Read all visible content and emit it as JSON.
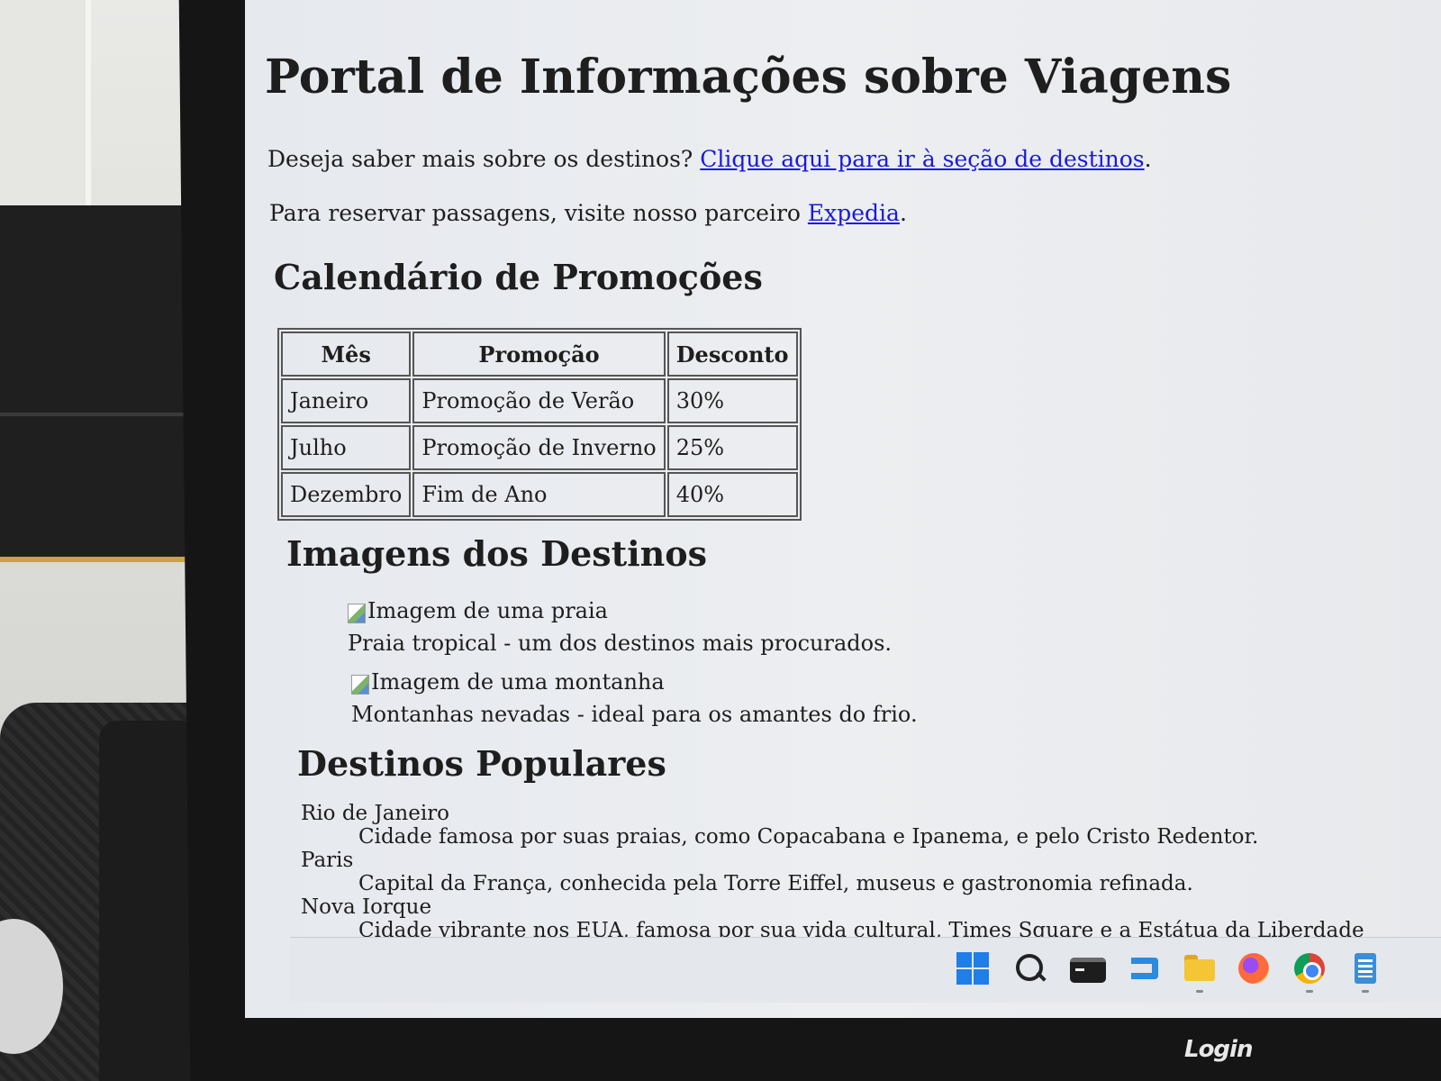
{
  "page": {
    "title": "Portal de Informações sobre Viagens",
    "intro": {
      "text": "Deseja saber mais sobre os destinos? ",
      "link_label": "Clique aqui para ir à seção de destinos",
      "suffix": "."
    },
    "booking": {
      "text": "Para reservar passagens, visite nosso parceiro ",
      "link_label": "Expedia",
      "suffix": "."
    }
  },
  "promotions": {
    "heading": "Calendário de Promoções",
    "columns": [
      "Mês",
      "Promoção",
      "Desconto"
    ],
    "rows": [
      [
        "Janeiro",
        "Promoção de Verão",
        "30%"
      ],
      [
        "Julho",
        "Promoção de Inverno",
        "25%"
      ],
      [
        "Dezembro",
        "Fim de Ano",
        "40%"
      ]
    ]
  },
  "images": {
    "heading": "Imagens dos Destinos",
    "figures": [
      {
        "alt": "Imagem de uma praia",
        "caption": "Praia tropical - um dos destinos mais procurados."
      },
      {
        "alt": "Imagem de uma montanha",
        "caption": "Montanhas nevadas - ideal para os amantes do frio."
      }
    ]
  },
  "popular": {
    "heading": "Destinos Populares",
    "items": [
      {
        "term": "Rio de Janeiro",
        "description": "Cidade famosa por suas praias, como Copacabana e Ipanema, e pelo Cristo Redentor."
      },
      {
        "term": "Paris",
        "description": "Capital da França, conhecida pela Torre Eiffel, museus e gastronomia refinada."
      },
      {
        "term": "Nova Iorque",
        "description": "Cidade vibrante nos EUA, famosa por sua vida cultural, Times Square e a Estátua da Liberdade"
      }
    ]
  },
  "taskbar": {
    "icons": [
      "windows-start-icon",
      "search-icon",
      "terminal-icon",
      "vscode-icon",
      "file-explorer-icon",
      "firefox-icon",
      "chrome-icon",
      "notepad-icon"
    ]
  },
  "monitor": {
    "brand": "Login"
  },
  "colors": {
    "link": "#1a1adc",
    "text": "#1e1e1e",
    "screen_bg": "#eceef1",
    "taskbar_bg": "#e4e7ec"
  }
}
